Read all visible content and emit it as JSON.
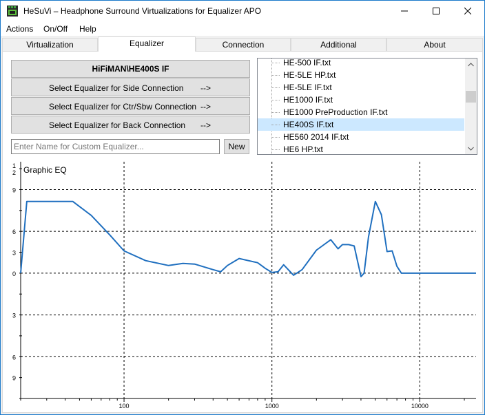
{
  "window": {
    "title": "HeSuVi – Headphone Surround Virtualizations for Equalizer APO",
    "minimize_glyph": "—",
    "maximize_glyph": "☐",
    "close_glyph": "✕"
  },
  "menu": {
    "items": [
      {
        "label": "Actions"
      },
      {
        "label": "On/Off"
      },
      {
        "label": "Help"
      }
    ]
  },
  "tabs": [
    {
      "label": "Virtualization",
      "active": false
    },
    {
      "label": "Equalizer",
      "active": true
    },
    {
      "label": "Connection",
      "active": false
    },
    {
      "label": "Additional",
      "active": false
    },
    {
      "label": "About",
      "active": false
    }
  ],
  "equalizer": {
    "current": "HiFiMAN\\HE400S IF",
    "side_label": "Select Equalizer for Side Connection",
    "side_arrow": "-->",
    "ctr_label": "Select Equalizer for Ctr/Sbw Connection",
    "ctr_arrow": "-->",
    "back_label": "Select Equalizer for Back Connection",
    "back_arrow": "-->",
    "custom_placeholder": "Enter Name for Custom Equalizer...",
    "new_label": "New"
  },
  "file_list": {
    "items": [
      {
        "label": "HE-500 IF.txt",
        "selected": false
      },
      {
        "label": "HE-5LE HP.txt",
        "selected": false
      },
      {
        "label": "HE-5LE IF.txt",
        "selected": false
      },
      {
        "label": "HE1000 IF.txt",
        "selected": false
      },
      {
        "label": "HE1000 PreProduction IF.txt",
        "selected": false
      },
      {
        "label": "HE400S IF.txt",
        "selected": true
      },
      {
        "label": "HE560 2014 IF.txt",
        "selected": false
      },
      {
        "label": "HE6 HP.txt",
        "selected": false
      }
    ]
  },
  "chart_data": {
    "type": "line",
    "title": "Graphic EQ",
    "xscale": "log",
    "x_ticks": [
      "100",
      "1000",
      "10000"
    ],
    "y_ticks_left": [
      "1\n2",
      "9",
      "6",
      "3",
      "0",
      "3",
      "6",
      "9"
    ],
    "line_color": "#1f6fbf",
    "grid": true,
    "x": [
      20,
      22,
      45,
      60,
      80,
      100,
      140,
      200,
      250,
      300,
      400,
      450,
      500,
      600,
      800,
      900,
      1000,
      1100,
      1200,
      1400,
      1600,
      2000,
      2500,
      2800,
      3000,
      3300,
      3600,
      4000,
      4200,
      4500,
      5000,
      5500,
      6000,
      6500,
      7000,
      7500,
      8500,
      10000,
      15000,
      24000
    ],
    "y": [
      0,
      10.3,
      10.3,
      8.3,
      5.5,
      3.2,
      1.8,
      1.1,
      1.4,
      1.3,
      0.5,
      0.2,
      1.1,
      2.1,
      1.5,
      0.7,
      0.1,
      0.2,
      1.2,
      -0.3,
      0.5,
      3.3,
      4.8,
      3.5,
      4.1,
      4.1,
      3.9,
      -0.5,
      0.0,
      5.2,
      10.3,
      8.4,
      3.1,
      3.2,
      1.0,
      0.0,
      0.0,
      0.0,
      0.0,
      0.0
    ],
    "ylim": [
      -18,
      16
    ]
  }
}
